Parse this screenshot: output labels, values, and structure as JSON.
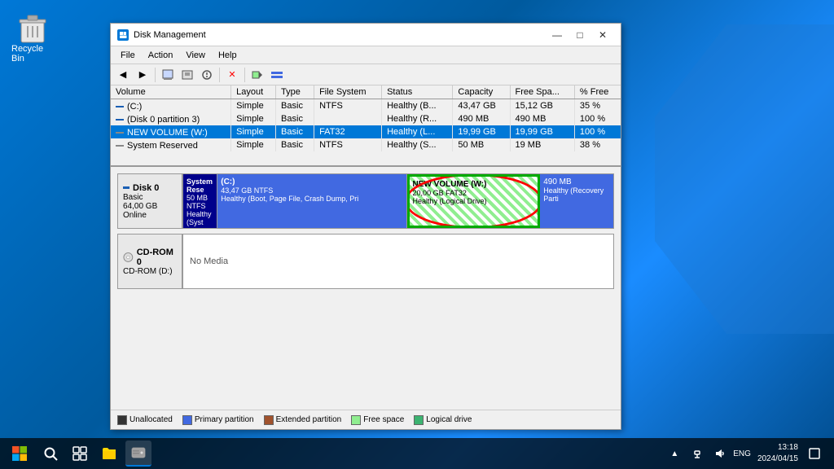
{
  "desktop": {
    "recycle_bin_label": "Recycle Bin"
  },
  "window": {
    "title": "Disk Management",
    "controls": {
      "minimize": "—",
      "maximize": "□",
      "close": "✕"
    }
  },
  "menu": {
    "items": [
      "File",
      "Action",
      "View",
      "Help"
    ]
  },
  "volume_table": {
    "columns": [
      "Volume",
      "Layout",
      "Type",
      "File System",
      "Status",
      "Capacity",
      "Free Spa...",
      "% Free"
    ],
    "rows": [
      {
        "volume": "(C:)",
        "layout": "Simple",
        "type": "Basic",
        "fs": "NTFS",
        "status": "Healthy (B...",
        "capacity": "43,47 GB",
        "free": "15,12 GB",
        "pct_free": "35 %"
      },
      {
        "volume": "(Disk 0 partition 3)",
        "layout": "Simple",
        "type": "Basic",
        "fs": "",
        "status": "Healthy (R...",
        "capacity": "490 MB",
        "free": "490 MB",
        "pct_free": "100 %"
      },
      {
        "volume": "NEW VOLUME (W:)",
        "layout": "Simple",
        "type": "Basic",
        "fs": "FAT32",
        "status": "Healthy (L...",
        "capacity": "19,99 GB",
        "free": "19,99 GB",
        "pct_free": "100 %"
      },
      {
        "volume": "System Reserved",
        "layout": "Simple",
        "type": "Basic",
        "fs": "NTFS",
        "status": "Healthy (S...",
        "capacity": "50 MB",
        "free": "19 MB",
        "pct_free": "38 %"
      }
    ]
  },
  "disk0": {
    "name": "Disk 0",
    "type": "Basic",
    "size": "64,00 GB",
    "status": "Online",
    "partitions": [
      {
        "label": "System Rese",
        "sub1": "50 MB NTFS",
        "sub2": "Healthy (Syst",
        "color": "dark-blue",
        "width": "5"
      },
      {
        "label": "(C:)",
        "sub1": "43,47 GB NTFS",
        "sub2": "Healthy (Boot, Page File, Crash Dump, Pri",
        "color": "blue",
        "width": "46"
      },
      {
        "label": "NEW VOLUME (W:)",
        "sub1": "20,00 GB FAT32",
        "sub2": "Healthy (Logical Drive)",
        "color": "green-selected",
        "width": "30"
      },
      {
        "label": "",
        "sub1": "490 MB",
        "sub2": "Healthy (Recovery Parti",
        "color": "recovery",
        "width": "8"
      }
    ]
  },
  "cdrom0": {
    "name": "CD-ROM 0",
    "type": "CD-ROM (D:)",
    "content": "No Media"
  },
  "legend": {
    "items": [
      {
        "type": "unallocated",
        "label": "Unallocated"
      },
      {
        "type": "primary",
        "label": "Primary partition"
      },
      {
        "type": "extended",
        "label": "Extended partition"
      },
      {
        "type": "free",
        "label": "Free space"
      },
      {
        "type": "logical",
        "label": "Logical drive"
      }
    ]
  },
  "taskbar": {
    "time": "13:18",
    "date": "2024/04/15",
    "lang": "ENG"
  }
}
